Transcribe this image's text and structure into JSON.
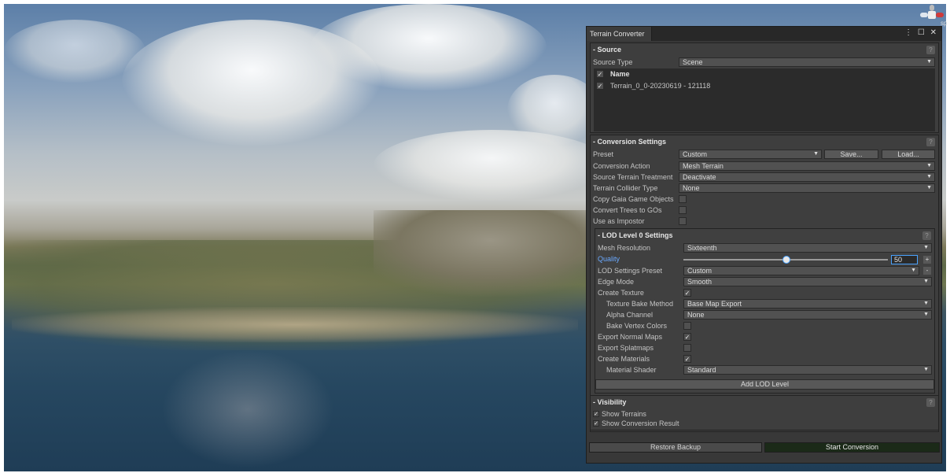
{
  "window": {
    "tab_title": "Terrain Converter",
    "controls": "⋮ ☐ ✕"
  },
  "gizmo": {
    "label": "sp"
  },
  "source": {
    "header": "- Source",
    "help": "?",
    "source_type_label": "Source Type",
    "source_type_value": "Scene",
    "name_header": "Name",
    "items": [
      {
        "checked": true,
        "label": "Terrain_0_0-20230619 - 121118"
      }
    ]
  },
  "conversion": {
    "header": "- Conversion Settings",
    "help": "?",
    "preset_label": "Preset",
    "preset_value": "Custom",
    "save_label": "Save...",
    "load_label": "Load...",
    "action_label": "Conversion Action",
    "action_value": "Mesh Terrain",
    "treatment_label": "Source Terrain Treatment",
    "treatment_value": "Deactivate",
    "collider_label": "Terrain Collider Type",
    "collider_value": "None",
    "copy_gaia_label": "Copy Gaia Game Objects",
    "convert_trees_label": "Convert Trees to GOs",
    "use_impostor_label": "Use as Impostor"
  },
  "lod": {
    "header": "- LOD Level 0 Settings",
    "help": "?",
    "mesh_resolution_label": "Mesh Resolution",
    "mesh_resolution_value": "Sixteenth",
    "quality_label": "Quality",
    "quality_value": "50",
    "quality_fraction": 0.5,
    "plus": "+",
    "minus": "-",
    "lod_preset_label": "LOD Settings Preset",
    "lod_preset_value": "Custom",
    "edge_mode_label": "Edge Mode",
    "edge_mode_value": "Smooth",
    "create_texture_label": "Create Texture",
    "texture_bake_label": "Texture Bake Method",
    "texture_bake_value": "Base Map Export",
    "alpha_label": "Alpha Channel",
    "alpha_value": "None",
    "bake_vertex_label": "Bake Vertex Colors",
    "export_normal_label": "Export Normal Maps",
    "export_splat_label": "Export Splatmaps",
    "create_materials_label": "Create Materials",
    "material_shader_label": "Material Shader",
    "material_shader_value": "Standard",
    "add_lod_label": "Add LOD Level"
  },
  "visibility": {
    "header": "- Visibility",
    "help": "?",
    "show_terrains_label": "Show Terrains",
    "show_result_label": "Show Conversion Result"
  },
  "footer": {
    "restore_label": "Restore Backup",
    "start_label": "Start Conversion"
  },
  "colors": {
    "panel_bg": "#383838",
    "section_bg": "#3e3e3e",
    "accent_blue": "#4aa3ff",
    "start_button_bg": "#1b2a18"
  }
}
